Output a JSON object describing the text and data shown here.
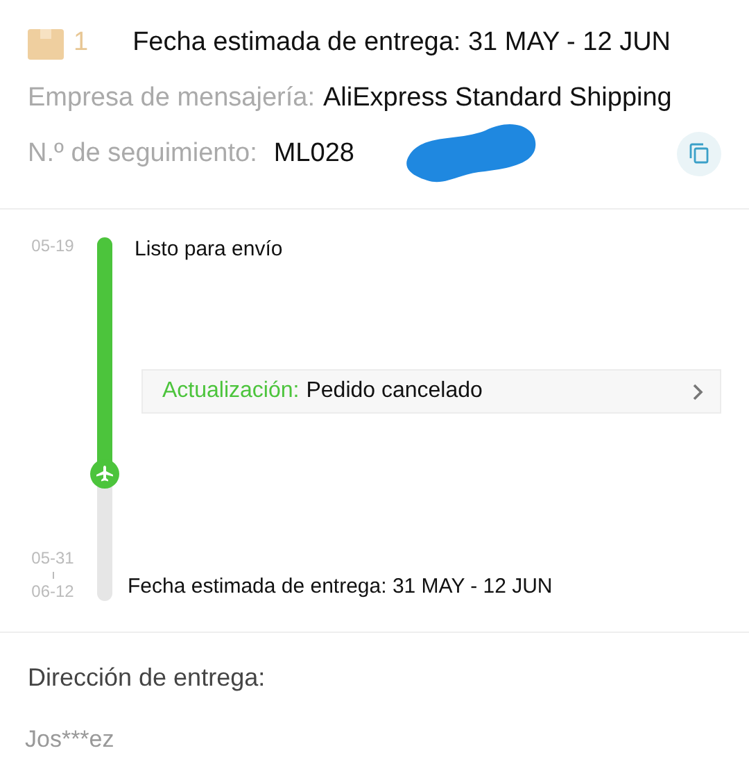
{
  "shipment": {
    "package_count": "1",
    "estimate": "Fecha estimada de entrega: 31 MAY - 12 JUN",
    "carrier_label": "Empresa de mensajería:",
    "carrier": "AliExpress Standard Shipping",
    "tracking_label": "N.º de seguimiento:",
    "tracking_number": "ML028",
    "tracking_redacted": true
  },
  "timeline": {
    "level": 0.65,
    "events": [
      {
        "kind": "event",
        "dates": [
          "05-19"
        ],
        "text": "Listo para envío"
      },
      {
        "kind": "update",
        "label": "Actualización:",
        "text": "Pedido cancelado"
      },
      {
        "kind": "event",
        "dates": [
          "05-31",
          "06-12"
        ],
        "text": "Fecha estimada de entrega: 31 MAY - 12 JUN"
      }
    ]
  },
  "address": {
    "title": "Dirección de entrega:",
    "name": "Jos***ez"
  }
}
